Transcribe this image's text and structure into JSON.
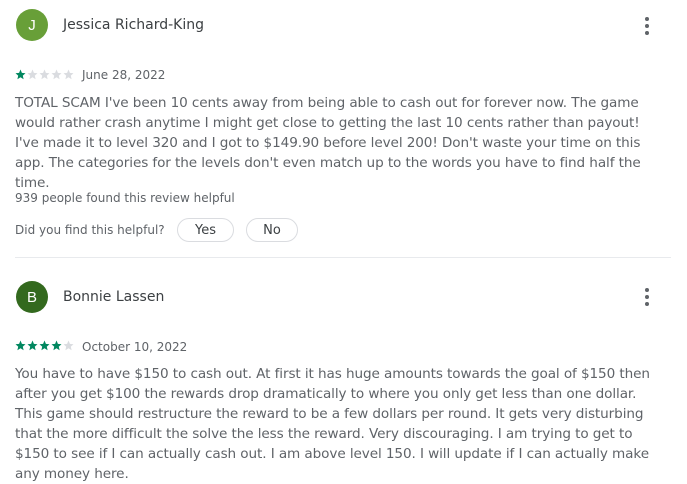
{
  "reviews": [
    {
      "author": "Jessica Richard-King",
      "avatar_letter": "J",
      "avatar_color": "#689f38",
      "rating": 1,
      "date": "June 28, 2022",
      "text": "TOTAL SCAM I've been 10 cents away from being able to cash out for forever now. The game would rather crash anytime I might get close to getting the last 10 cents rather than payout! I've made it to level 320 and I got to $149.90 before level 200! Don't waste your time on this app. The categories for the levels don't even match up to the words you have to find half the time.",
      "helpful_count_text": "939 people found this review helpful",
      "helpful_question": "Did you find this helpful?",
      "yes_label": "Yes",
      "no_label": "No"
    },
    {
      "author": "Bonnie Lassen",
      "avatar_letter": "B",
      "avatar_color": "#33691e",
      "rating": 4,
      "date": "October 10, 2022",
      "text": "You have to have $150 to cash out. At first it has huge amounts towards the goal of $150 then after you get $100 the rewards drop dramatically to where you only get less than one dollar. This game should restructure the reward to be a few dollars per round. It gets very disturbing that the more difficult the solve the less the reward. Very discouraging. I am trying to get to $150 to see if I can actually cash out. I am above level 150. I will update if I can actually make any money here."
    }
  ],
  "colors": {
    "star_filled": "#01875f",
    "star_empty": "#dadce0"
  },
  "icons": {
    "more": "more-vert-icon",
    "star": "star-icon"
  }
}
